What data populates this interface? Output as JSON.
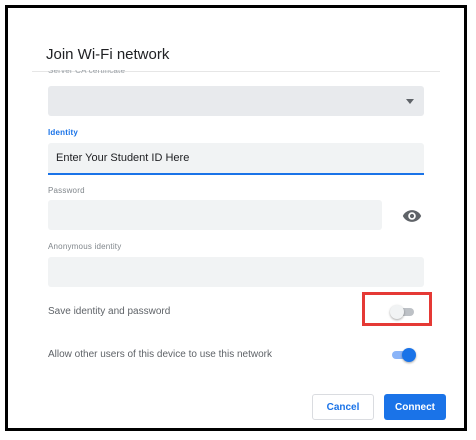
{
  "dialog": {
    "title": "Join Wi-Fi network",
    "server_ca_label": "Server CA certificate"
  },
  "identity": {
    "label": "Identity",
    "value": "Enter Your Student ID Here"
  },
  "password": {
    "label": "Password",
    "value": ""
  },
  "anonymous_identity": {
    "label": "Anonymous identity",
    "value": ""
  },
  "options": {
    "save_label": "Save identity and password",
    "save_enabled": false,
    "allow_label": "Allow other users of this device to use this network",
    "allow_enabled": true
  },
  "buttons": {
    "cancel": "Cancel",
    "connect": "Connect"
  },
  "colors": {
    "accent": "#1a73e8",
    "highlight": "#e53935"
  }
}
